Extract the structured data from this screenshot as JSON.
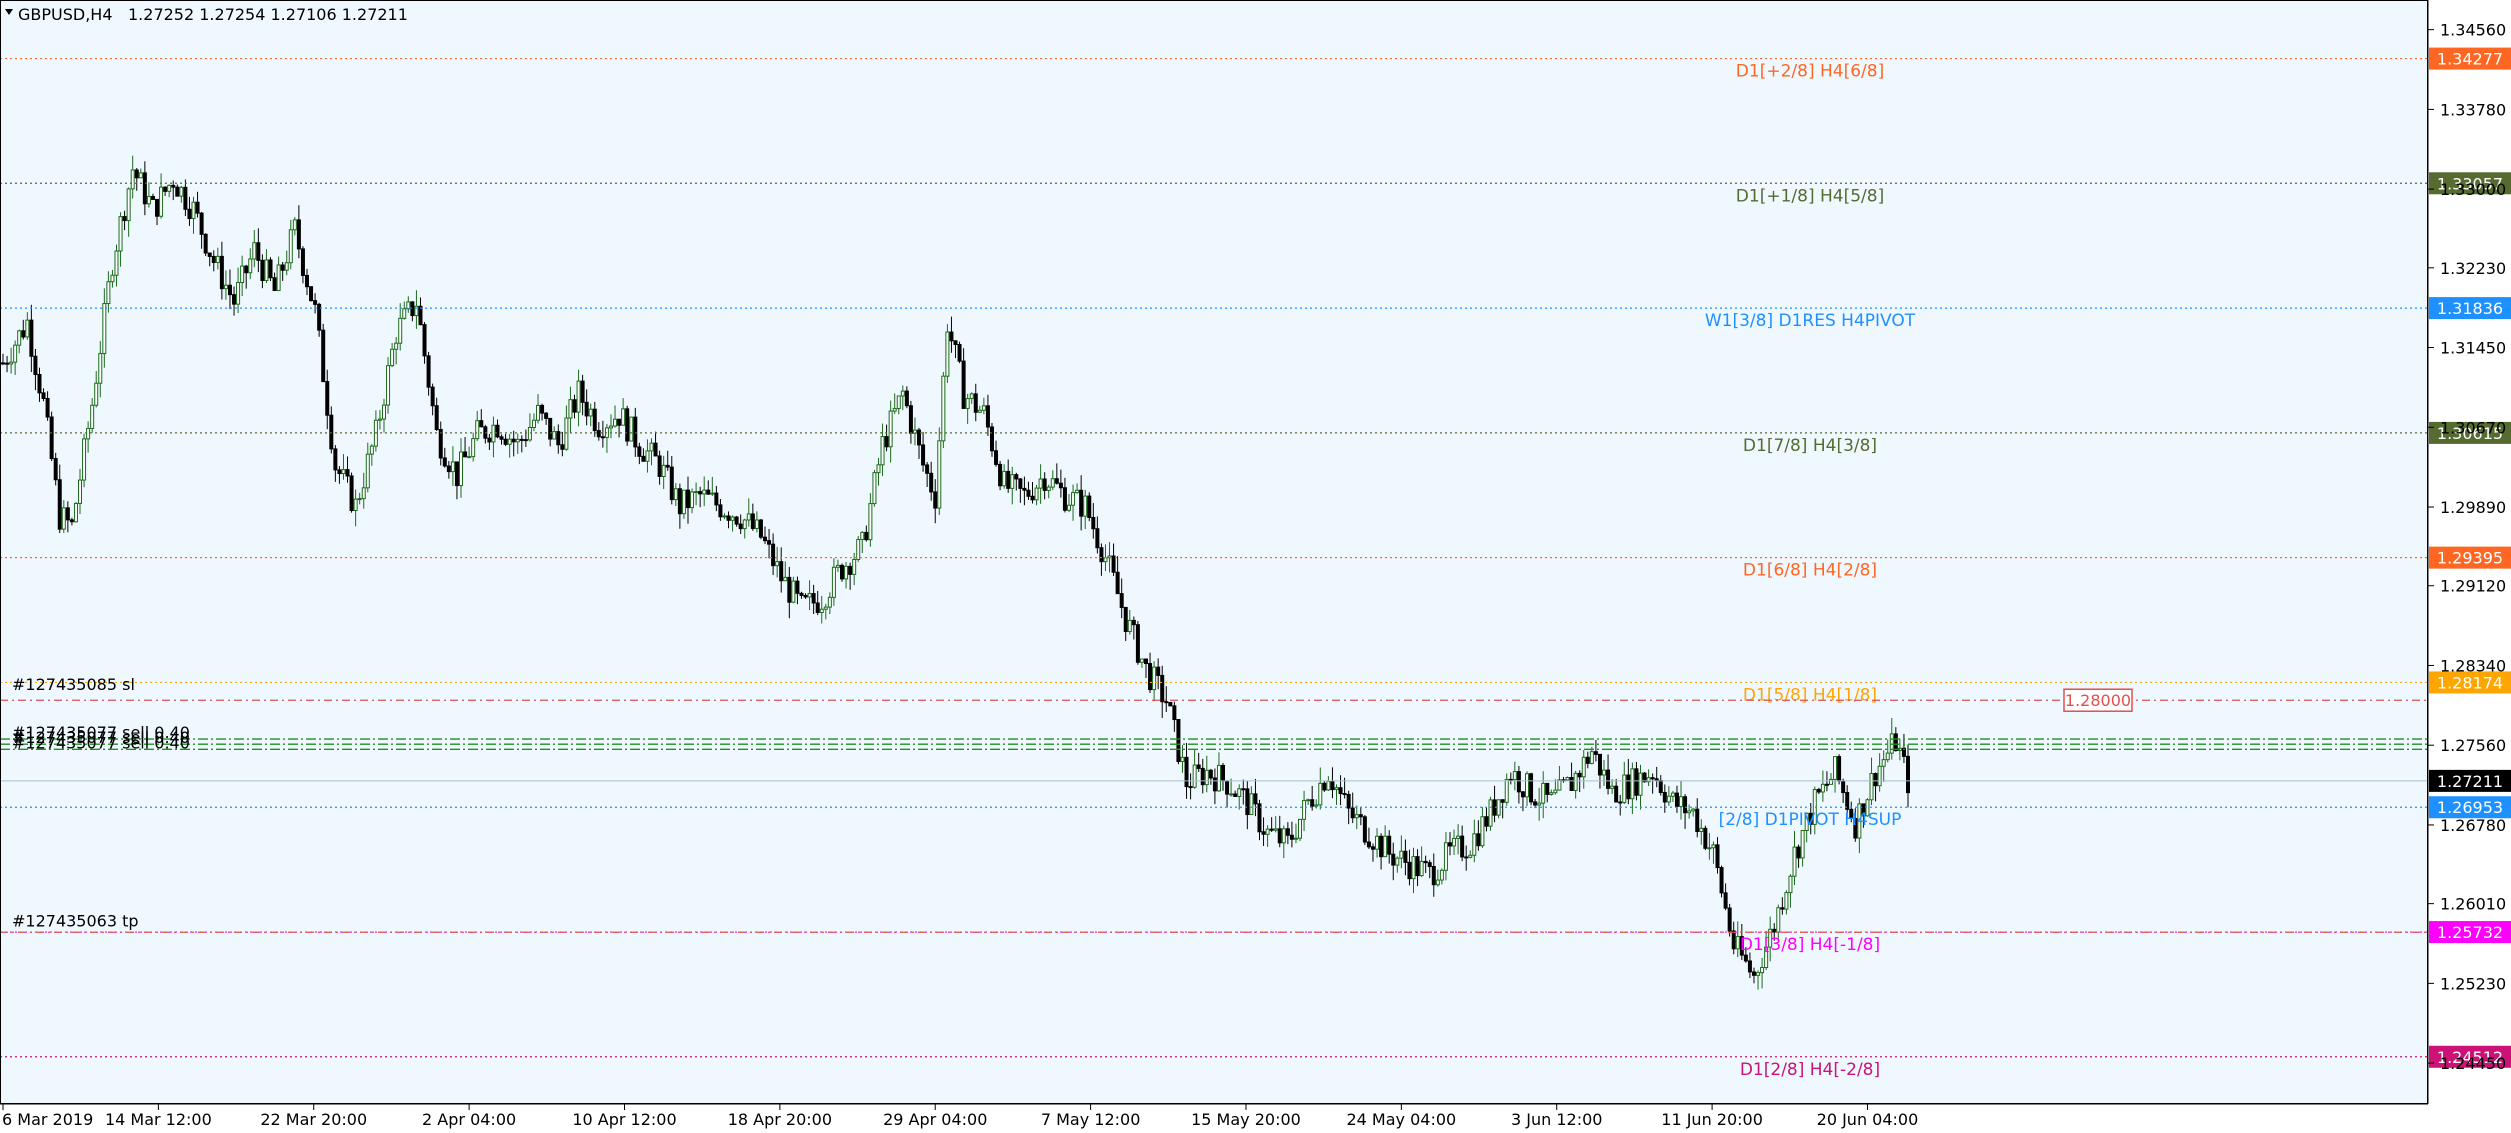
{
  "header": {
    "symbol": "GBPUSD,H4",
    "ohlc": "1.27252 1.27254 1.27106 1.27211"
  },
  "colors": {
    "background": "#f0f8ff",
    "bull_candle": "#1a6b1a",
    "bear_candle": "#000000",
    "grid": "#c8c8c8"
  },
  "chart_data": {
    "type": "candlestick",
    "symbol": "GBPUSD",
    "timeframe": "H4",
    "ylim": [
      1.2405,
      1.3485
    ],
    "y_ticks": [
      "1.34560",
      "1.33780",
      "1.33000",
      "1.32230",
      "1.31450",
      "1.30670",
      "1.29890",
      "1.29120",
      "1.28340",
      "1.27560",
      "1.26780",
      "1.26010",
      "1.25230",
      "1.24450"
    ],
    "x_ticks": [
      "6 Mar 2019",
      "14 Mar 12:00",
      "22 Mar 20:00",
      "2 Apr 04:00",
      "10 Apr 12:00",
      "18 Apr 20:00",
      "29 Apr 04:00",
      "7 May 12:00",
      "15 May 20:00",
      "24 May 04:00",
      "3 Jun 12:00",
      "11 Jun 20:00",
      "20 Jun 04:00"
    ],
    "price_path": [
      [
        0,
        1.313
      ],
      [
        6,
        1.317
      ],
      [
        10,
        1.309
      ],
      [
        14,
        1.298
      ],
      [
        17,
        1.297
      ],
      [
        22,
        1.309
      ],
      [
        27,
        1.323
      ],
      [
        32,
        1.332
      ],
      [
        37,
        1.328
      ],
      [
        42,
        1.331
      ],
      [
        47,
        1.328
      ],
      [
        52,
        1.323
      ],
      [
        57,
        1.319
      ],
      [
        62,
        1.324
      ],
      [
        67,
        1.32
      ],
      [
        72,
        1.326
      ],
      [
        77,
        1.318
      ],
      [
        82,
        1.303
      ],
      [
        87,
        1.299
      ],
      [
        92,
        1.306
      ],
      [
        97,
        1.316
      ],
      [
        102,
        1.319
      ],
      [
        107,
        1.306
      ],
      [
        112,
        1.302
      ],
      [
        117,
        1.306
      ],
      [
        122,
        1.307
      ],
      [
        127,
        1.305
      ],
      [
        132,
        1.308
      ],
      [
        137,
        1.305
      ],
      [
        142,
        1.31
      ],
      [
        147,
        1.307
      ],
      [
        152,
        1.308
      ],
      [
        157,
        1.305
      ],
      [
        162,
        1.303
      ],
      [
        167,
        1.299
      ],
      [
        172,
        1.3
      ],
      [
        177,
        1.299
      ],
      [
        182,
        1.298
      ],
      [
        187,
        1.296
      ],
      [
        192,
        1.292
      ],
      [
        197,
        1.289
      ],
      [
        202,
        1.29
      ],
      [
        207,
        1.293
      ],
      [
        212,
        1.295
      ],
      [
        217,
        1.305
      ],
      [
        222,
        1.31
      ],
      [
        227,
        1.303
      ],
      [
        230,
        1.3
      ],
      [
        233,
        1.317
      ],
      [
        237,
        1.31
      ],
      [
        242,
        1.308
      ],
      [
        247,
        1.301
      ],
      [
        252,
        1.3
      ],
      [
        257,
        1.302
      ],
      [
        262,
        1.3
      ],
      [
        267,
        1.299
      ],
      [
        272,
        1.294
      ],
      [
        277,
        1.288
      ],
      [
        282,
        1.283
      ],
      [
        287,
        1.28
      ],
      [
        292,
        1.272
      ],
      [
        297,
        1.273
      ],
      [
        302,
        1.272
      ],
      [
        307,
        1.27
      ],
      [
        312,
        1.267
      ],
      [
        317,
        1.266
      ],
      [
        322,
        1.27
      ],
      [
        327,
        1.273
      ],
      [
        332,
        1.269
      ],
      [
        337,
        1.267
      ],
      [
        342,
        1.265
      ],
      [
        347,
        1.264
      ],
      [
        352,
        1.263
      ],
      [
        357,
        1.265
      ],
      [
        362,
        1.266
      ],
      [
        367,
        1.269
      ],
      [
        372,
        1.273
      ],
      [
        377,
        1.271
      ],
      [
        382,
        1.27
      ],
      [
        387,
        1.272
      ],
      [
        392,
        1.275
      ],
      [
        397,
        1.271
      ],
      [
        402,
        1.272
      ],
      [
        407,
        1.273
      ],
      [
        412,
        1.27
      ],
      [
        417,
        1.269
      ],
      [
        422,
        1.265
      ],
      [
        427,
        1.256
      ],
      [
        432,
        1.253
      ],
      [
        437,
        1.258
      ],
      [
        442,
        1.265
      ],
      [
        447,
        1.27
      ],
      [
        452,
        1.273
      ],
      [
        457,
        1.268
      ],
      [
        462,
        1.273
      ],
      [
        467,
        1.276
      ],
      [
        470,
        1.2721
      ]
    ],
    "levels": [
      {
        "label": "D1[+2/8] H4[6/8]",
        "price": "1.34277",
        "color": "#ff6622"
      },
      {
        "label": "D1[+1/8] H4[5/8]",
        "price": "1.33057",
        "color": "#556b2f"
      },
      {
        "label": "W1[3/8] D1RES H4PIVOT",
        "price": "1.31836",
        "color": "#1e90ff"
      },
      {
        "label": "D1[7/8] H4[3/8]",
        "price": "1.30615",
        "color": "#556b2f"
      },
      {
        "label": "D1[6/8] H4[2/8]",
        "price": "1.29395",
        "color": "#ff6622"
      },
      {
        "label": "D1[5/8] H4[1/8]",
        "price": "1.28174",
        "color": "#ffa500"
      },
      {
        "label": "[2/8] D1PIVOT H4SUP",
        "price": "1.26953",
        "color": "#1e90ff"
      },
      {
        "label": "D1[3/8] H4[-1/8]",
        "price": "1.25732",
        "color": "#ff00ff"
      },
      {
        "label": "D1[2/8] H4[-2/8]",
        "price": "1.24512",
        "color": "#cc1177"
      }
    ],
    "current_price": "1.27211",
    "orders": {
      "sl_label": "#127435085 sl",
      "sl_price": "1.28000",
      "tp_label": "#127435063 tp",
      "tp_price": 1.2573,
      "sell_label": "#127435077 sell 0.40",
      "sell_prices": [
        1.2762,
        1.2757,
        1.2752
      ]
    }
  }
}
